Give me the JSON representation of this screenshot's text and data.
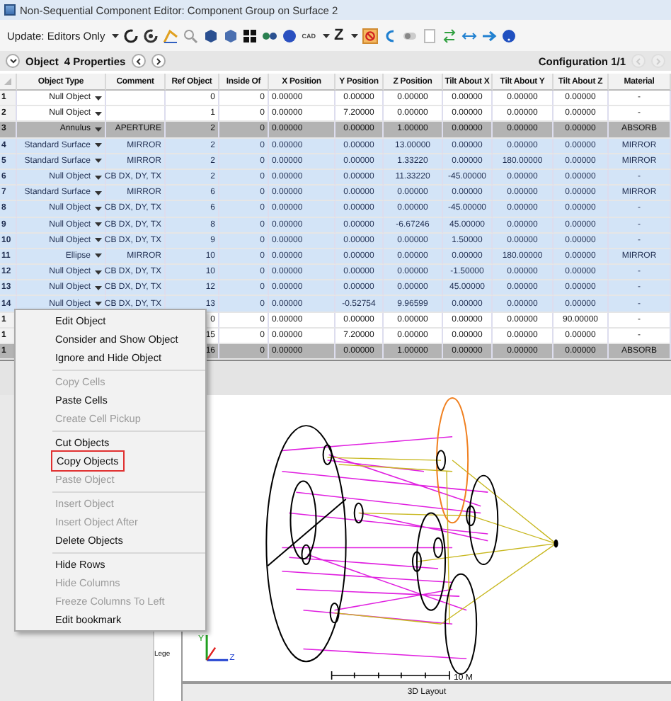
{
  "window": {
    "title": "Non-Sequential Component Editor: Component Group on Surface 2"
  },
  "toolbar": {
    "update_mode": "Update: Editors Only",
    "cad": "CAD",
    "z": "Z"
  },
  "properties_bar": {
    "object": "Object",
    "properties": "4 Properties",
    "configuration": "Configuration 1/1"
  },
  "table": {
    "columns": [
      "Object Type",
      "Comment",
      "Ref Object",
      "Inside Of",
      "X Position",
      "Y Position",
      "Z Position",
      "Tilt About X",
      "Tilt About Y",
      "Tilt About Z",
      "Material"
    ],
    "rows": [
      {
        "number": "1",
        "cells": [
          "Null Object",
          "",
          "0",
          "0",
          "0.00000",
          "0.00000",
          "0.00000",
          "0.00000",
          "0.00000",
          "0.00000",
          "-"
        ],
        "selected": false,
        "greyed": false
      },
      {
        "number": "2",
        "cells": [
          "Null Object",
          "",
          "1",
          "0",
          "0.00000",
          "7.20000",
          "0.00000",
          "0.00000",
          "0.00000",
          "0.00000",
          "-"
        ],
        "selected": false,
        "greyed": false
      },
      {
        "number": "3",
        "cells": [
          "Annulus",
          "APERTURE",
          "2",
          "0",
          "0.00000",
          "0.00000",
          "1.00000",
          "0.00000",
          "0.00000",
          "0.00000",
          "ABSORB"
        ],
        "selected": false,
        "greyed": true
      },
      {
        "number": "4",
        "cells": [
          "Standard Surface",
          "MIRROR",
          "2",
          "0",
          "0.00000",
          "0.00000",
          "13.00000",
          "0.00000",
          "0.00000",
          "0.00000",
          "MIRROR"
        ],
        "selected": true,
        "greyed": false
      },
      {
        "number": "5",
        "cells": [
          "Standard Surface",
          "MIRROR",
          "2",
          "0",
          "0.00000",
          "0.00000",
          "1.33220",
          "0.00000",
          "180.00000",
          "0.00000",
          "MIRROR"
        ],
        "selected": true,
        "greyed": false
      },
      {
        "number": "6",
        "cells": [
          "Null Object",
          "CB DX, DY, TX",
          "2",
          "0",
          "0.00000",
          "0.00000",
          "11.33220",
          "-45.00000",
          "0.00000",
          "0.00000",
          "-"
        ],
        "selected": true,
        "greyed": false
      },
      {
        "number": "7",
        "cells": [
          "Standard Surface",
          "MIRROR",
          "6",
          "0",
          "0.00000",
          "0.00000",
          "0.00000",
          "0.00000",
          "0.00000",
          "0.00000",
          "MIRROR"
        ],
        "selected": true,
        "greyed": false
      },
      {
        "number": "8",
        "cells": [
          "Null Object",
          "CB DX, DY, TX",
          "6",
          "0",
          "0.00000",
          "0.00000",
          "0.00000",
          "-45.00000",
          "0.00000",
          "0.00000",
          "-"
        ],
        "selected": true,
        "greyed": false
      },
      {
        "number": "9",
        "cells": [
          "Null Object",
          "CB DX, DY, TX",
          "8",
          "0",
          "0.00000",
          "0.00000",
          "-6.67246",
          "45.00000",
          "0.00000",
          "0.00000",
          "-"
        ],
        "selected": true,
        "greyed": false
      },
      {
        "number": "10",
        "cells": [
          "Null Object",
          "CB DX, DY, TX",
          "9",
          "0",
          "0.00000",
          "0.00000",
          "0.00000",
          "1.50000",
          "0.00000",
          "0.00000",
          "-"
        ],
        "selected": true,
        "greyed": false
      },
      {
        "number": "11",
        "cells": [
          "Ellipse",
          "MIRROR",
          "10",
          "0",
          "0.00000",
          "0.00000",
          "0.00000",
          "0.00000",
          "180.00000",
          "0.00000",
          "MIRROR"
        ],
        "selected": true,
        "greyed": false
      },
      {
        "number": "12",
        "cells": [
          "Null Object",
          "CB DX, DY, TX",
          "10",
          "0",
          "0.00000",
          "0.00000",
          "0.00000",
          "-1.50000",
          "0.00000",
          "0.00000",
          "-"
        ],
        "selected": true,
        "greyed": false
      },
      {
        "number": "13",
        "cells": [
          "Null Object",
          "CB DX, DY, TX",
          "12",
          "0",
          "0.00000",
          "0.00000",
          "0.00000",
          "45.00000",
          "0.00000",
          "0.00000",
          "-"
        ],
        "selected": true,
        "greyed": false
      },
      {
        "number": "14",
        "cells": [
          "Null Object",
          "CB DX, DY, TX",
          "13",
          "0",
          "0.00000",
          "-0.52754",
          "9.96599",
          "0.00000",
          "0.00000",
          "0.00000",
          "-"
        ],
        "selected": true,
        "greyed": false
      },
      {
        "number": "1",
        "cells": [
          null,
          null,
          "0",
          "0",
          "0.00000",
          "0.00000",
          "0.00000",
          "0.00000",
          "0.00000",
          "90.00000",
          "-"
        ],
        "selected": false,
        "greyed": false
      },
      {
        "number": "1",
        "cells": [
          null,
          null,
          "15",
          "0",
          "0.00000",
          "7.20000",
          "0.00000",
          "0.00000",
          "0.00000",
          "0.00000",
          "-"
        ],
        "selected": false,
        "greyed": false
      },
      {
        "number": "1",
        "cells": [
          null,
          null,
          "16",
          "0",
          "0.00000",
          "0.00000",
          "1.00000",
          "0.00000",
          "0.00000",
          "0.00000",
          "ABSORB"
        ],
        "selected": false,
        "greyed": true
      }
    ]
  },
  "context_menu": {
    "groups": [
      [
        {
          "label": "Edit Object",
          "disabled": false,
          "outlined": false
        },
        {
          "label": "Consider and Show Object",
          "disabled": false,
          "outlined": false
        },
        {
          "label": "Ignore and Hide Object",
          "disabled": false,
          "outlined": false
        }
      ],
      [
        {
          "label": "Copy Cells",
          "disabled": true,
          "outlined": false
        },
        {
          "label": "Paste Cells",
          "disabled": false,
          "outlined": false
        },
        {
          "label": "Create Cell Pickup",
          "disabled": true,
          "outlined": false
        }
      ],
      [
        {
          "label": "Cut Objects",
          "disabled": false,
          "outlined": false
        },
        {
          "label": "Copy Objects",
          "disabled": false,
          "outlined": true
        },
        {
          "label": "Paste Object",
          "disabled": true,
          "outlined": false
        }
      ],
      [
        {
          "label": "Insert Object",
          "disabled": true,
          "outlined": false
        },
        {
          "label": "Insert Object After",
          "disabled": true,
          "outlined": false
        },
        {
          "label": "Delete Objects",
          "disabled": false,
          "outlined": false
        }
      ],
      [
        {
          "label": "Hide Rows",
          "disabled": false,
          "outlined": false
        },
        {
          "label": "Hide Columns",
          "disabled": true,
          "outlined": false
        },
        {
          "label": "Freeze Columns To Left",
          "disabled": true,
          "outlined": false
        },
        {
          "label": "Edit bookmark",
          "disabled": false,
          "outlined": false
        }
      ]
    ]
  },
  "side_panel": {
    "label": "Lege"
  },
  "layout_view": {
    "axis_labels": [
      "Y",
      "Z"
    ],
    "scale": "10 M",
    "tab": "3D Layout"
  }
}
